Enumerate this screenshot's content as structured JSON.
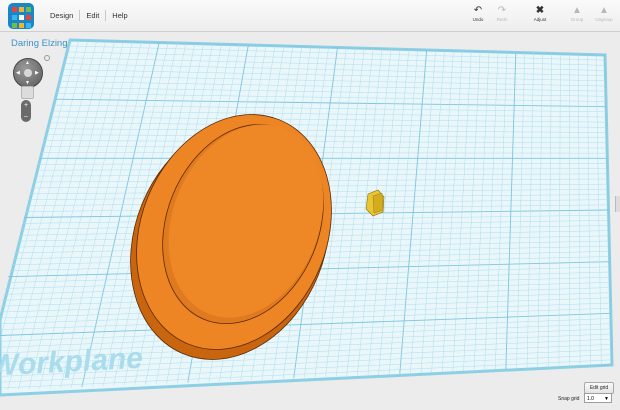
{
  "app": {
    "menu": [
      "Design",
      "Edit",
      "Help"
    ]
  },
  "toolbar": {
    "undo_label": "Undo",
    "redo_label": "Redo",
    "adjust_label": "Adjust",
    "group_label": "Group",
    "ungroup_label": "Ungroup"
  },
  "design": {
    "title": "Daring Elzing"
  },
  "workplane": {
    "label": "Workplane"
  },
  "grid": {
    "edit_label": "Edit grid",
    "snap_label": "Snap grid",
    "snap_value": "1.0"
  },
  "colors": {
    "grid_line": "#a9dcec",
    "grid_major": "#7cc6e0",
    "plane": "#e9f6fa",
    "object_orange": "#ed8525",
    "object_yellow": "#e8c531",
    "title_blue": "#3b94c6"
  },
  "icons": {
    "undo": "undo-arrow-icon",
    "redo": "redo-arrow-icon",
    "adjust": "adjust-cross-icon",
    "group": "group-shapes-icon",
    "ungroup": "ungroup-shapes-icon"
  }
}
